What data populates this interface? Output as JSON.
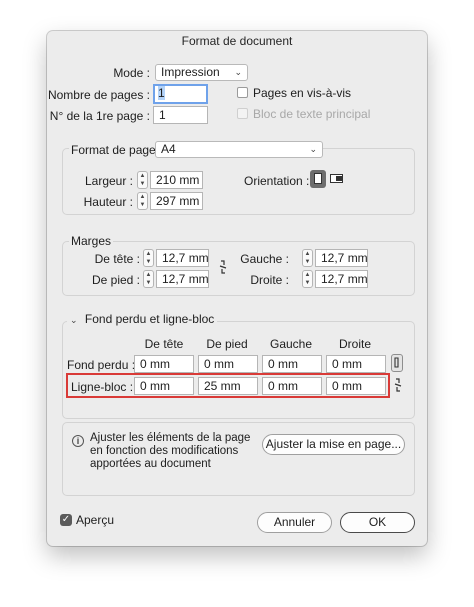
{
  "window": {
    "title": "Format de document"
  },
  "mode": {
    "label": "Mode :",
    "value": "Impression"
  },
  "pages": {
    "count_label": "Nombre de pages :",
    "count_value": "1",
    "first_label": "N° de la 1re page :",
    "first_value": "1",
    "facing_label": "Pages en vis-à-vis",
    "facing_checked": false,
    "primary_frame_label": "Bloc de texte principal",
    "primary_frame_checked": false
  },
  "page_size": {
    "label": "Format de page :",
    "value": "A4",
    "width_label": "Largeur :",
    "width_value": "210 mm",
    "height_label": "Hauteur :",
    "height_value": "297 mm",
    "orientation_label": "Orientation :"
  },
  "margins": {
    "title": "Marges",
    "top_label": "De tête :",
    "top_value": "12,7 mm",
    "bottom_label": "De pied :",
    "bottom_value": "12,7 mm",
    "left_label": "Gauche :",
    "left_value": "12,7 mm",
    "right_label": "Droite :",
    "right_value": "12,7 mm"
  },
  "bleed_slug": {
    "title": "Fond perdu et ligne-bloc",
    "columns": [
      "De tête",
      "De pied",
      "Gauche",
      "Droite"
    ],
    "bleed_label": "Fond perdu :",
    "bleed_values": [
      "0 mm",
      "0 mm",
      "0 mm",
      "0 mm"
    ],
    "slug_label": "Ligne-bloc :",
    "slug_values": [
      "0 mm",
      "25 mm",
      "0 mm",
      "0 mm"
    ]
  },
  "adjust": {
    "info": "Ajuster les éléments de la page en fonction des modifications apportées au document",
    "button": "Ajuster la mise en page..."
  },
  "footer": {
    "preview_label": "Aperçu",
    "preview_checked": true,
    "cancel": "Annuler",
    "ok": "OK"
  },
  "colors": {
    "accent": "#2f6fd8",
    "highlight": "#d93a37",
    "focus_ring": "#6fa2ea"
  }
}
